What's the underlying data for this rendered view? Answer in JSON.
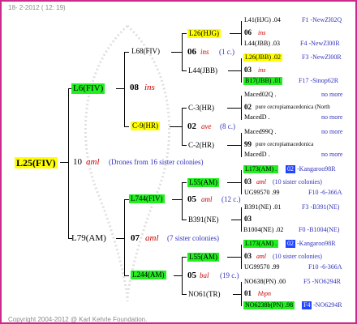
{
  "header": "18-  2-2012 ( 12: 19)",
  "copyright": "Copyright 2004-2012 @ Karl Kehrle Foundation.",
  "root": {
    "id": "L25(FIV)",
    "gen": "10",
    "breed": "aml",
    "note": "(Drones from 16 sister colonies)"
  },
  "sire": {
    "id": "L6(FIV)",
    "gen": "08",
    "breed": "ins"
  },
  "dam": {
    "id": "L79(AM)",
    "gen": "07",
    "breed": "aml",
    "note": "(7 sister colonies)"
  },
  "ss": {
    "id": "L68(FIV)",
    "gen": "06",
    "breed": "ins",
    "note": "(1 c.)"
  },
  "sd": {
    "id": "C-9(HR)",
    "gen": "02",
    "breed": "ave",
    "note": "(8 c.)"
  },
  "ds": {
    "id": "L744(FIV)",
    "gen": "05",
    "breed": "aml",
    "note": "(12 c.)"
  },
  "dd": {
    "id": "L244(AM)",
    "gen": "05",
    "breed": "bal",
    "note": "(19 c.)"
  },
  "g3": [
    {
      "id": "L26(HJG)",
      "bg": "y"
    },
    {
      "id": "L44(JBB)"
    },
    {
      "id": "C-3(HR)"
    },
    {
      "id": "C-2(HR)"
    },
    {
      "id": "L55(AM)",
      "bg": "g"
    },
    {
      "id": "B391(NE)"
    },
    {
      "id": "L55(AM)",
      "bg": "g"
    },
    {
      "id": "NO61(TR)"
    }
  ],
  "g4": [
    {
      "a": "L41(HJG) .04",
      "b": "F1 -NewZl02Q"
    },
    {
      "gen": "06",
      "breed": "ins"
    },
    {
      "a": "L44(JBB) .03",
      "b": "F4 -NewZl00R"
    },
    {
      "a": "L26(JBB) .02",
      "b": "F3 -NewZl00R",
      "bg": "y"
    },
    {
      "gen": "03",
      "breed": "ins"
    },
    {
      "a": "B17(JBB) .01",
      "b": "F17 -Sinop62R",
      "bg": "g"
    },
    {
      "a": "Maced02Q .",
      "b": "no more"
    },
    {
      "gen": "02",
      "breed": "pure cecropiamacedonica (North"
    },
    {
      "a": "MacedD .",
      "b": "no more"
    },
    {
      "a": "Maced99Q .",
      "b": "no more"
    },
    {
      "gen": "99",
      "breed": "pure cecropiamacedonica"
    },
    {
      "a": "MacedD .",
      "b": "no more"
    },
    {
      "a": "L173(AM) .",
      "a2": "02",
      "b": "-Kangaroo98R",
      "bg": "g"
    },
    {
      "gen": "03",
      "breed": "aml",
      "note": "(10 sister colonies)"
    },
    {
      "a": "UG99570 .99",
      "b": "F10 -6-366A"
    },
    {
      "a": "B391(NE) .01",
      "b": "F3 -B391(NE)"
    },
    {
      "gen": "03"
    },
    {
      "a": "B1004(NE) .02",
      "b": "F0 -B1004(NE)"
    },
    {
      "a": "L173(AM) .",
      "a2": "02",
      "b": "-Kangaroo98R",
      "bg": "g"
    },
    {
      "gen": "03",
      "breed": "aml",
      "note": "(10 sister colonies)"
    },
    {
      "a": "UG99570 .99",
      "b": "F10 -6-366A"
    },
    {
      "a": "NO638(PN) .00",
      "b": "F5 -NO6294R"
    },
    {
      "gen": "01",
      "breed": "hbpn"
    },
    {
      "a": "NO6238b(PN) .98",
      "a2": "F4",
      "b": "-NO6294R",
      "bg": "g"
    }
  ]
}
